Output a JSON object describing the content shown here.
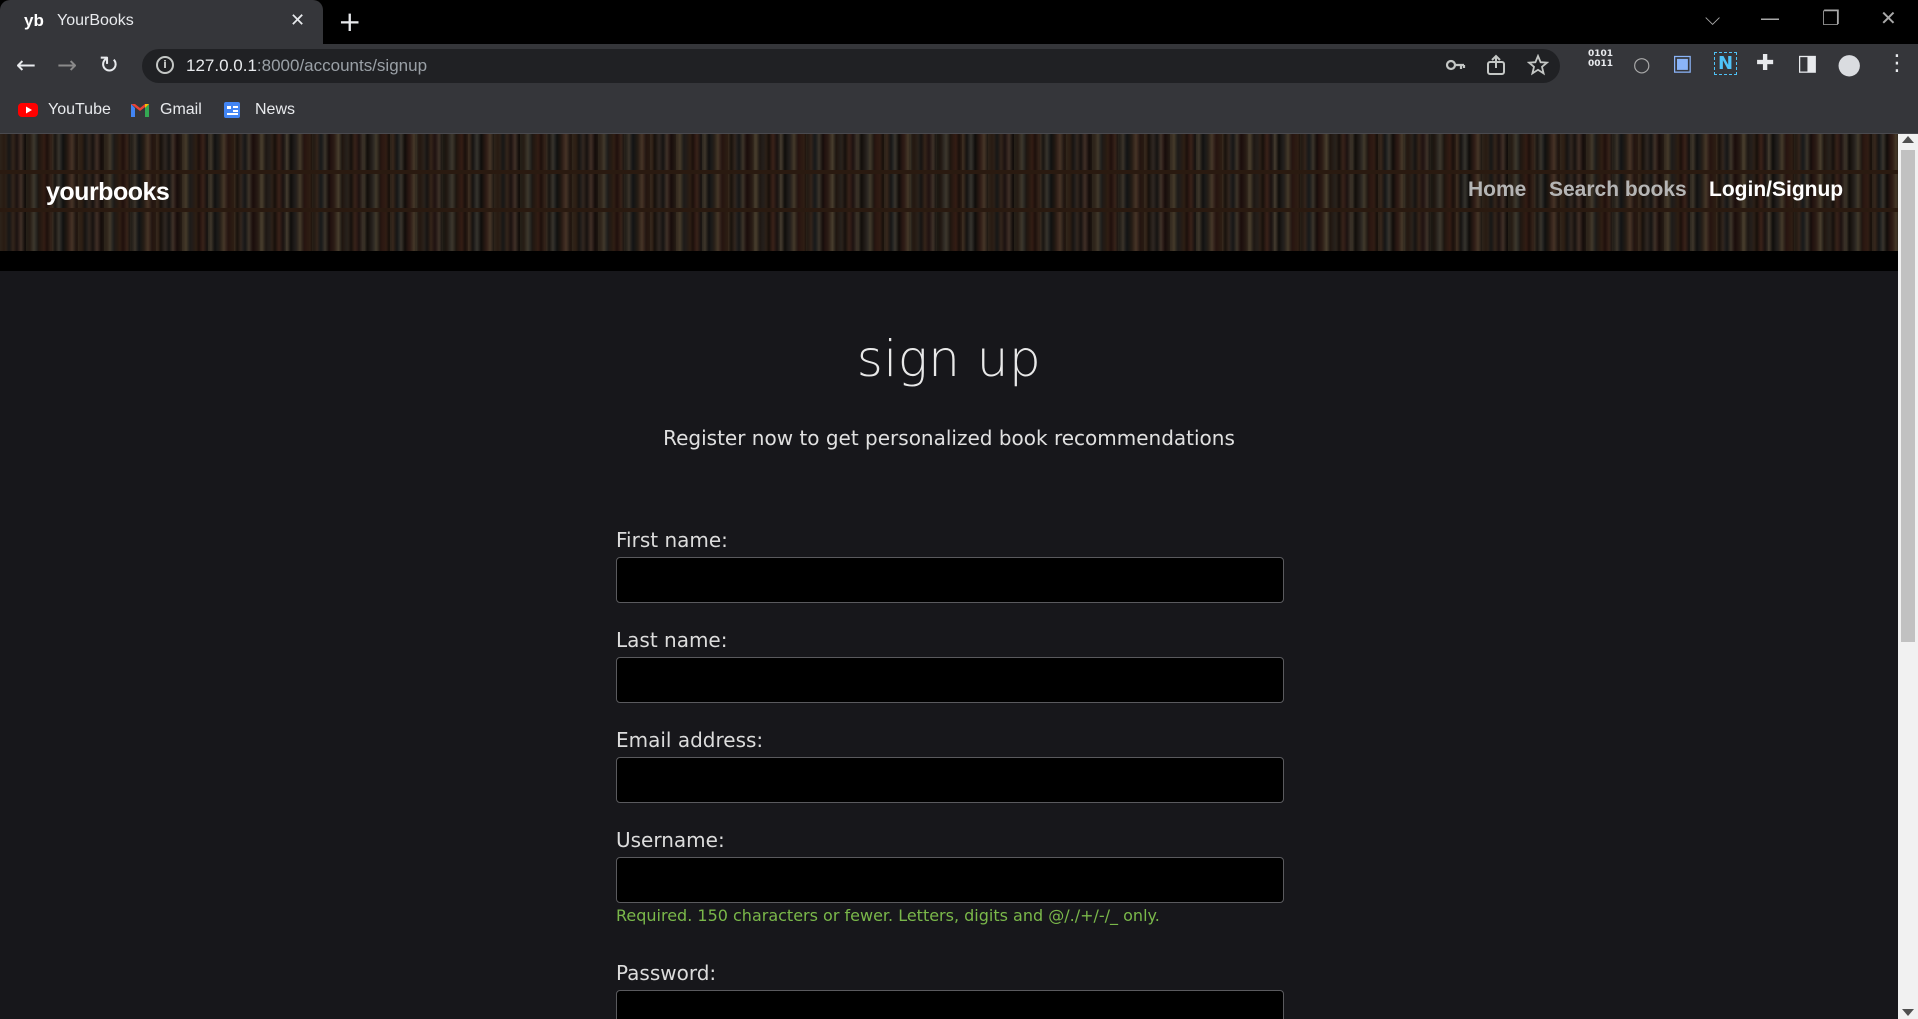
{
  "browser": {
    "tab": {
      "favicon_text": "yb",
      "title": "YourBooks",
      "close_glyph": "✕"
    },
    "new_tab_glyph": "+",
    "window_controls": [
      "⌵",
      "—",
      "❐",
      "✕"
    ],
    "nav": {
      "back": "←",
      "forward": "→",
      "reload": "↻"
    },
    "address": {
      "host": "127.0.0.1",
      "rest": ":8000/accounts/signup"
    },
    "omnibox_actions": [
      "key-icon",
      "share-icon",
      "star-icon"
    ],
    "extensions": [
      {
        "name": "binary-extension-icon",
        "glyph": "0101\n0011"
      },
      {
        "name": "circle-extension-icon",
        "glyph": "○"
      },
      {
        "name": "screenshot-extension-icon",
        "glyph": "▣"
      },
      {
        "name": "notion-extension-icon",
        "glyph": "N"
      },
      {
        "name": "puzzle-extensions-icon",
        "glyph": "✚"
      },
      {
        "name": "side-panel-icon",
        "glyph": "◨"
      },
      {
        "name": "profile-avatar-icon",
        "glyph": "●"
      },
      {
        "name": "menu-kebab-icon",
        "glyph": "⋮"
      }
    ],
    "bookmarks": [
      {
        "label": "YouTube",
        "icon": "youtube-icon"
      },
      {
        "label": "Gmail",
        "icon": "gmail-icon"
      },
      {
        "label": "News",
        "icon": "google-news-icon"
      }
    ]
  },
  "site": {
    "brand": "yourbooks",
    "nav": [
      {
        "label": "Home",
        "active": false
      },
      {
        "label": "Search books",
        "active": false
      },
      {
        "label": "Login/Signup",
        "active": true
      }
    ]
  },
  "signup": {
    "title": "sign up",
    "subtitle": "Register now to get personalized book recommendations",
    "fields": [
      {
        "label": "First name:",
        "value": ""
      },
      {
        "label": "Last name:",
        "value": ""
      },
      {
        "label": "Email address:",
        "value": ""
      },
      {
        "label": "Username:",
        "value": ""
      },
      {
        "label": "Password:",
        "value": ""
      }
    ],
    "username_help": "Required. 150 characters or fewer. Letters, digits and @/./+/-/_ only."
  },
  "colors": {
    "page_bg": "#17171b",
    "help_text": "#7ab84a",
    "chrome_bg": "#35363a"
  }
}
